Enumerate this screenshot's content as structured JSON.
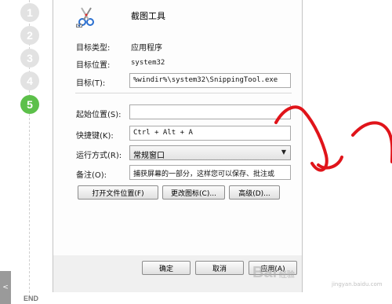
{
  "steps": {
    "items": [
      {
        "label": "1"
      },
      {
        "label": "2"
      },
      {
        "label": "3"
      },
      {
        "label": "4"
      },
      {
        "label": "5"
      }
    ],
    "active_index": 4,
    "end_label": "END",
    "side_tab_label": "<"
  },
  "dialog": {
    "app_icon": "snipping-tool-scissors-icon",
    "app_name": "截图工具",
    "target_type": {
      "label": "目标类型:",
      "value": "应用程序"
    },
    "target_location": {
      "label": "目标位置:",
      "value": "system32"
    },
    "target": {
      "label": "目标(T):",
      "value": "%windir%\\system32\\SnippingTool.exe"
    },
    "start_in": {
      "label": "起始位置(S):",
      "value": ""
    },
    "shortcut_key": {
      "label": "快捷键(K):",
      "value": "Ctrl + Alt + A"
    },
    "run": {
      "label": "运行方式(R):",
      "value": "常规窗口"
    },
    "comment": {
      "label": "备注(O):",
      "value": "捕获屏幕的一部分，这样您可以保存、批注或"
    },
    "buttons": {
      "open_location": "打开文件位置(F)",
      "change_icon": "更改图标(C)...",
      "advanced": "高级(D)..."
    },
    "footer": {
      "ok": "确定",
      "cancel": "取消",
      "apply": "应用(A)"
    }
  },
  "watermark": {
    "main": "Bai",
    "sub": "jingyan.baidu.com"
  },
  "colors": {
    "active_step": "#5cc04a",
    "inactive_step": "#e2e2e2",
    "annotation": "#e0141a"
  }
}
